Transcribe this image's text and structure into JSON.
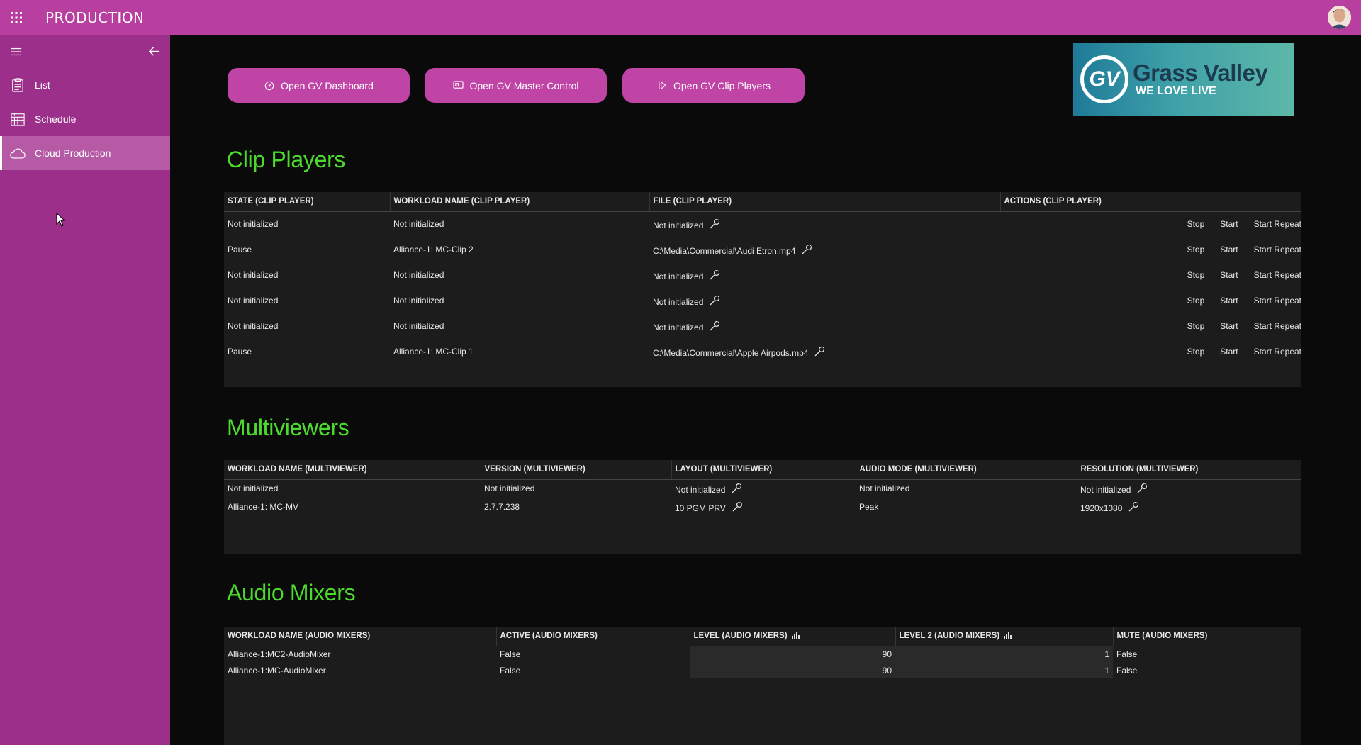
{
  "app": {
    "title": "PRODUCTION"
  },
  "sidebar": {
    "items": [
      {
        "label": "List",
        "icon": "clipboard-icon"
      },
      {
        "label": "Schedule",
        "icon": "calendar-icon"
      },
      {
        "label": "Cloud Production",
        "icon": "cloud-icon",
        "active": true
      }
    ]
  },
  "buttons": {
    "dashboard": "Open GV Dashboard",
    "master_control": "Open GV Master Control",
    "clip_players": "Open GV Clip Players"
  },
  "logo": {
    "mark": "GV",
    "name": "Grass Valley",
    "tagline": "WE LOVE LIVE"
  },
  "clip_players": {
    "title": "Clip Players",
    "headers": [
      "STATE (CLIP PLAYER)",
      "WORKLOAD NAME (CLIP PLAYER)",
      "FILE (CLIP PLAYER)",
      "ACTIONS (CLIP PLAYER)"
    ],
    "actions": [
      "Stop",
      "Start",
      "Start Repeat"
    ],
    "rows": [
      {
        "state": "Not initialized",
        "workload": "Not initialized",
        "file": "Not initialized"
      },
      {
        "state": "Pause",
        "workload": "Alliance-1: MC-Clip 2",
        "file": "C:\\Media\\Commercial\\Audi Etron.mp4"
      },
      {
        "state": "Not initialized",
        "workload": "Not initialized",
        "file": "Not initialized"
      },
      {
        "state": "Not initialized",
        "workload": "Not initialized",
        "file": "Not initialized"
      },
      {
        "state": "Not initialized",
        "workload": "Not initialized",
        "file": "Not initialized"
      },
      {
        "state": "Pause",
        "workload": "Alliance-1: MC-Clip 1",
        "file": "C:\\Media\\Commercial\\Apple Airpods.mp4"
      }
    ]
  },
  "multiviewers": {
    "title": "Multiviewers",
    "headers": [
      "WORKLOAD NAME (MULTIVIEWER)",
      "VERSION (MULTIVIEWER)",
      "LAYOUT (MULTIVIEWER)",
      "AUDIO MODE (MULTIVIEWER)",
      "RESOLUTION (MULTIVIEWER)"
    ],
    "rows": [
      {
        "workload": "Not initialized",
        "version": "Not initialized",
        "layout": "Not initialized",
        "audio_mode": "Not initialized",
        "resolution": "Not initialized"
      },
      {
        "workload": "Alliance-1: MC-MV",
        "version": "2.7.7.238",
        "layout": "10 PGM PRV",
        "audio_mode": "Peak",
        "resolution": "1920x1080"
      }
    ]
  },
  "audio_mixers": {
    "title": "Audio Mixers",
    "headers": [
      "WORKLOAD NAME (AUDIO MIXERS)",
      "ACTIVE (AUDIO MIXERS)",
      "LEVEL (AUDIO MIXERS)",
      "LEVEL 2 (AUDIO MIXERS)",
      "MUTE (AUDIO MIXERS)"
    ],
    "rows": [
      {
        "workload": "Alliance-1:MC2-AudioMixer",
        "active": "False",
        "level": "90",
        "level2": "1",
        "mute": "False"
      },
      {
        "workload": "Alliance-1:MC-AudioMixer",
        "active": "False",
        "level": "90",
        "level2": "1",
        "mute": "False"
      }
    ]
  },
  "colors": {
    "header": "#b83fa0",
    "sidebar": "#9c2f8a",
    "button": "#c044a6",
    "section_title": "#4cdb2c",
    "panel": "#1c1c1c"
  }
}
